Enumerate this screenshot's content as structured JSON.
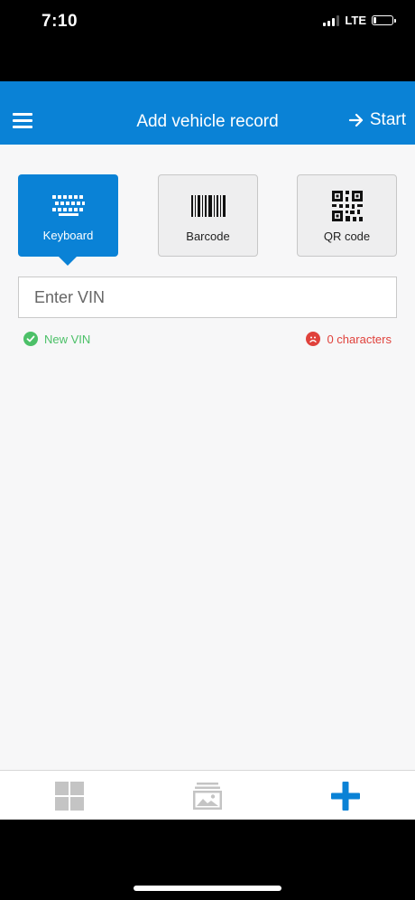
{
  "status_bar": {
    "time": "7:10",
    "network": "LTE"
  },
  "header": {
    "title": "Add vehicle record",
    "start_label": "Start",
    "menu_icon": "hamburger-menu-icon",
    "start_icon": "arrow-right-icon"
  },
  "input_methods": [
    {
      "label": "Keyboard",
      "icon": "keyboard-icon",
      "active": true
    },
    {
      "label": "Barcode",
      "icon": "barcode-icon",
      "active": false
    },
    {
      "label": "QR code",
      "icon": "qr-code-icon",
      "active": false
    }
  ],
  "vin_field": {
    "placeholder": "Enter VIN",
    "value": ""
  },
  "validation": {
    "vin_status": "New VIN",
    "char_count": "0 characters"
  },
  "tab_bar": {
    "tabs": [
      {
        "icon": "grid-icon",
        "active": false
      },
      {
        "icon": "gallery-icon",
        "active": false
      },
      {
        "icon": "add-icon",
        "active": true
      }
    ]
  },
  "colors": {
    "primary": "#0a82d6",
    "success": "#4cc068",
    "error": "#e0423c",
    "inactive_icon": "#c4c4c4"
  }
}
